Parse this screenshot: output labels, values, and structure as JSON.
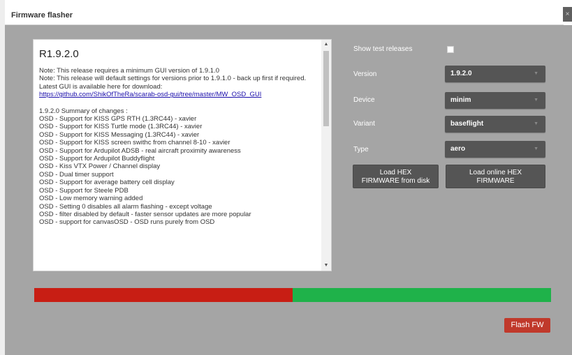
{
  "window": {
    "title": "Firmware flasher",
    "close_glyph": "×"
  },
  "release_notes": {
    "title": "R1.9.2.0",
    "intro": [
      "Note: This release requires a minimum GUI version of 1.9.1.0",
      "Note: This release will default settings for versions prior to 1.9.1.0 - back up first if required.",
      "Latest GUI is available here for download:"
    ],
    "link": "https://github.com/ShikOfTheRa/scarab-osd-gui/tree/master/MW_OSD_GUI",
    "summary_header": "1.9.2.0 Summary of changes :",
    "changes": [
      "OSD - Support for KISS GPS RTH (1.3RC44) - xavier",
      "OSD - Support for KISS Turtle mode (1.3RC44) - xavier",
      "OSD - Support for KISS Messaging (1.3RC44) - xavier",
      "OSD - Support for KISS screen swithc from channel 8-10 - xavier",
      "OSD - Support for Ardupilot ADSB - real aircraft proximity awareness",
      "OSD - Support for Ardupilot Buddyflight",
      "OSD - Kiss VTX Power / Channel display",
      "OSD - Dual timer support",
      "OSD - Support for average battery cell display",
      "OSD - Support for Steele PDB",
      "OSD - Low memory warning added",
      "OSD - Setting 0 disables all alarm flashing - except voltage",
      "OSD - filter disabled by default - faster sensor updates are more popular",
      "OSD - support for canvasOSD - OSD runs purely from OSD"
    ]
  },
  "options": {
    "show_test_releases_label": "Show test releases",
    "show_test_releases_checked": false,
    "version_label": "Version",
    "version_value": "1.9.2.0",
    "device_label": "Device",
    "device_value": "minim",
    "variant_label": "Variant",
    "variant_value": "baseflight",
    "type_label": "Type",
    "type_value": "aero",
    "chevron_glyph": "▼"
  },
  "buttons": {
    "load_hex_disk_line1": "Load HEX",
    "load_hex_disk_line2": "FIRMWARE from disk",
    "load_hex_online_line1": "Load online HEX",
    "load_hex_online_line2": "FIRMWARE",
    "flash_label": "Flash FW"
  },
  "progress": {
    "fraction": 0.5,
    "fill_color": "#c81e14",
    "track_color": "#1fb24a"
  },
  "icons": {
    "scroll_up": "▲",
    "scroll_down": "▼"
  }
}
